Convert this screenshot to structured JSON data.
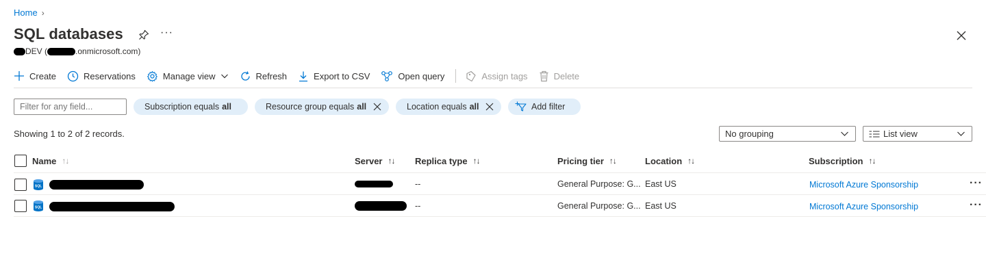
{
  "breadcrumb": {
    "home": "Home",
    "separator": "›"
  },
  "page": {
    "title": "SQL databases",
    "more": "···",
    "subtitle_prefix": "DEV (",
    "subtitle_suffix": ".onmicrosoft.com)"
  },
  "toolbar": {
    "create": "Create",
    "reservations": "Reservations",
    "manage_view": "Manage view",
    "refresh": "Refresh",
    "export": "Export to CSV",
    "open_query": "Open query",
    "assign_tags": "Assign tags",
    "delete": "Delete"
  },
  "filters": {
    "search_placeholder": "Filter for any field...",
    "pills": [
      {
        "label": "Subscription equals",
        "value": "all"
      },
      {
        "label": "Resource group equals",
        "value": "all"
      },
      {
        "label": "Location equals",
        "value": "all"
      }
    ],
    "add_filter": "Add filter"
  },
  "records_text": "Showing 1 to 2 of 2 records.",
  "grouping": {
    "selected": "No grouping"
  },
  "view": {
    "selected": "List view",
    "icon": "list-view-icon"
  },
  "table": {
    "columns": {
      "name": "Name",
      "server": "Server",
      "replica_type": "Replica type",
      "pricing_tier": "Pricing tier",
      "location": "Location",
      "subscription": "Subscription"
    },
    "sort_glyph": "↑↓",
    "rows": [
      {
        "replica_type": "--",
        "pricing_tier": "General Purpose: G...",
        "location": "East US",
        "subscription": "Microsoft Azure Sponsorship",
        "more": "···"
      },
      {
        "replica_type": "--",
        "pricing_tier": "General Purpose: G...",
        "location": "East US",
        "subscription": "Microsoft Azure Sponsorship",
        "more": "···"
      }
    ]
  },
  "colors": {
    "accent": "#0078d4",
    "pill_bg": "#e1eef9",
    "text": "#323130",
    "disabled": "#a19f9d"
  }
}
